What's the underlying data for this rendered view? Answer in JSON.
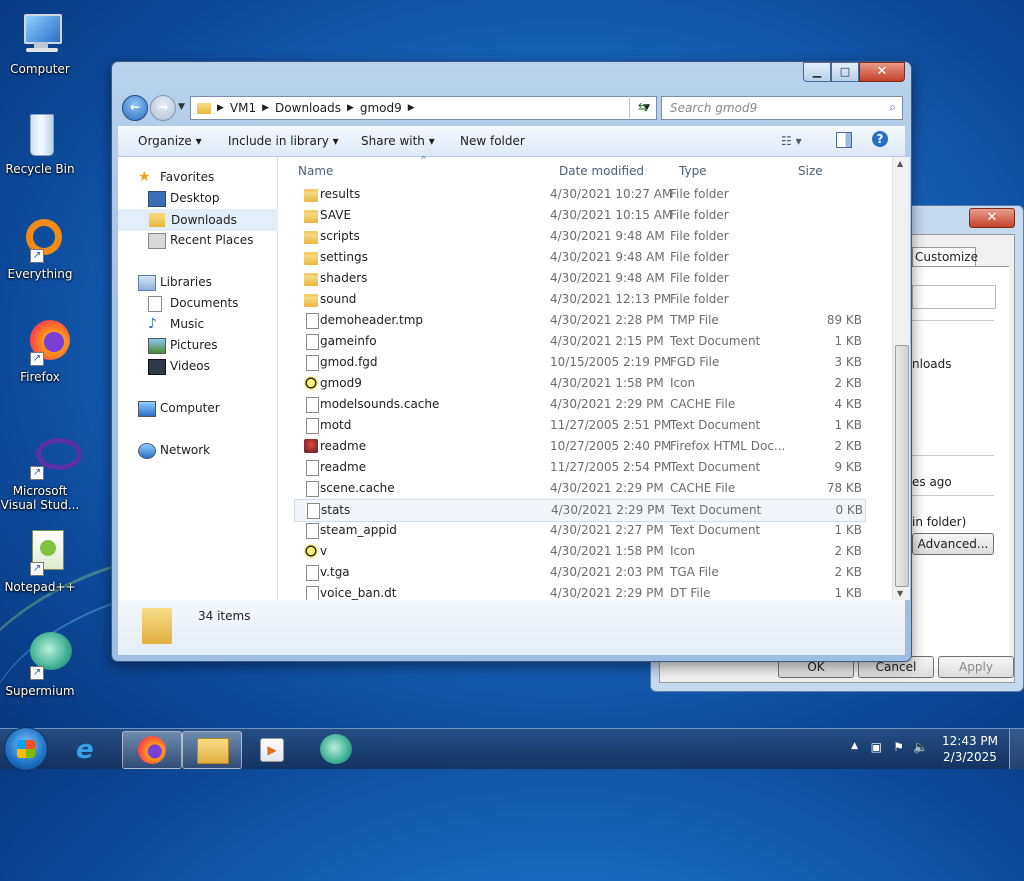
{
  "desktop": {
    "icons": [
      {
        "label": "Computer"
      },
      {
        "label": "Recycle Bin"
      },
      {
        "label": "Everything"
      },
      {
        "label": "Firefox"
      },
      {
        "label": "Microsoft Visual Stud..."
      },
      {
        "label": "Notepad++"
      },
      {
        "label": "Supermium"
      }
    ]
  },
  "background_dialog": {
    "tab_customize": "Customize",
    "text_nloads": "nloads",
    "text_es_ago": "es ago",
    "text_in_folder": "in folder)",
    "advanced_button": "Advanced...",
    "ok_button": "OK",
    "cancel_button": "Cancel",
    "apply_button": "Apply"
  },
  "explorer": {
    "breadcrumb": [
      "VM1",
      "Downloads",
      "gmod9"
    ],
    "search_placeholder": "Search gmod9",
    "toolbar": {
      "organize": "Organize",
      "include_in_library": "Include in library",
      "share_with": "Share with",
      "new_folder": "New folder"
    },
    "nav": {
      "favorites": "Favorites",
      "desktop": "Desktop",
      "downloads": "Downloads",
      "recent_places": "Recent Places",
      "libraries": "Libraries",
      "documents": "Documents",
      "music": "Music",
      "pictures": "Pictures",
      "videos": "Videos",
      "computer": "Computer",
      "network": "Network"
    },
    "columns": {
      "name": "Name",
      "date": "Date modified",
      "type": "Type",
      "size": "Size"
    },
    "files": [
      {
        "name": "results",
        "date": "4/30/2021 10:27 AM",
        "type": "File folder",
        "size": "",
        "icon": "folder-icon"
      },
      {
        "name": "SAVE",
        "date": "4/30/2021 10:15 AM",
        "type": "File folder",
        "size": "",
        "icon": "folder-icon"
      },
      {
        "name": "scripts",
        "date": "4/30/2021 9:48 AM",
        "type": "File folder",
        "size": "",
        "icon": "folder-icon"
      },
      {
        "name": "settings",
        "date": "4/30/2021 9:48 AM",
        "type": "File folder",
        "size": "",
        "icon": "folder-icon"
      },
      {
        "name": "shaders",
        "date": "4/30/2021 9:48 AM",
        "type": "File folder",
        "size": "",
        "icon": "folder-icon"
      },
      {
        "name": "sound",
        "date": "4/30/2021 12:13 PM",
        "type": "File folder",
        "size": "",
        "icon": "folder-icon"
      },
      {
        "name": "demoheader.tmp",
        "date": "4/30/2021 2:28 PM",
        "type": "TMP File",
        "size": "89 KB",
        "icon": "document-icon"
      },
      {
        "name": "gameinfo",
        "date": "4/30/2021 2:15 PM",
        "type": "Text Document",
        "size": "1 KB",
        "icon": "document-icon"
      },
      {
        "name": "gmod.fgd",
        "date": "10/15/2005 2:19 PM",
        "type": "FGD File",
        "size": "3 KB",
        "icon": "document-icon"
      },
      {
        "name": "gmod9",
        "date": "4/30/2021 1:58 PM",
        "type": "Icon",
        "size": "2 KB",
        "icon": "gmod-icon"
      },
      {
        "name": "modelsounds.cache",
        "date": "4/30/2021 2:29 PM",
        "type": "CACHE File",
        "size": "4 KB",
        "icon": "document-icon"
      },
      {
        "name": "motd",
        "date": "11/27/2005 2:51 PM",
        "type": "Text Document",
        "size": "1 KB",
        "icon": "document-icon"
      },
      {
        "name": "readme",
        "date": "10/27/2005 2:40 PM",
        "type": "Firefox HTML Doc...",
        "size": "2 KB",
        "icon": "html-icon"
      },
      {
        "name": "readme",
        "date": "11/27/2005 2:54 PM",
        "type": "Text Document",
        "size": "9 KB",
        "icon": "document-icon"
      },
      {
        "name": "scene.cache",
        "date": "4/30/2021 2:29 PM",
        "type": "CACHE File",
        "size": "78 KB",
        "icon": "document-icon"
      },
      {
        "name": "stats",
        "date": "4/30/2021 2:29 PM",
        "type": "Text Document",
        "size": "0 KB",
        "icon": "document-icon"
      },
      {
        "name": "steam_appid",
        "date": "4/30/2021 2:27 PM",
        "type": "Text Document",
        "size": "1 KB",
        "icon": "document-icon"
      },
      {
        "name": "v",
        "date": "4/30/2021 1:58 PM",
        "type": "Icon",
        "size": "2 KB",
        "icon": "gmod-icon"
      },
      {
        "name": "v.tga",
        "date": "4/30/2021 2:03 PM",
        "type": "TGA File",
        "size": "2 KB",
        "icon": "document-icon"
      },
      {
        "name": "voice_ban.dt",
        "date": "4/30/2021 2:29 PM",
        "type": "DT File",
        "size": "1 KB",
        "icon": "document-icon"
      }
    ],
    "selected_index": 15,
    "item_count": "34 items"
  },
  "taskbar": {
    "time": "12:43 PM",
    "date": "2/3/2025"
  }
}
